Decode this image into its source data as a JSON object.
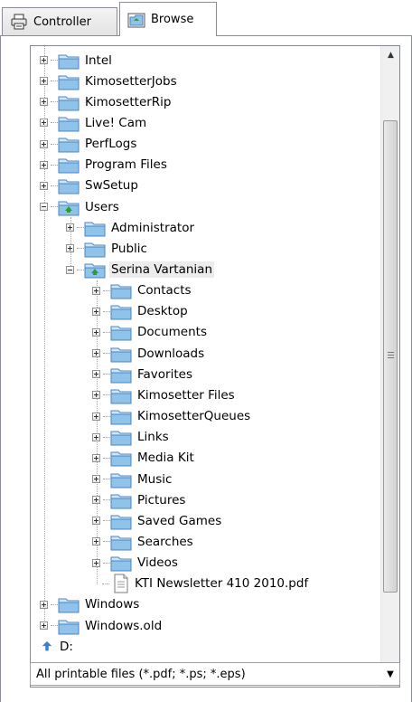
{
  "tabs": [
    {
      "label": "Controller",
      "icon": "printer-icon",
      "active": false
    },
    {
      "label": "Browse",
      "icon": "browse-folder-icon",
      "active": true
    }
  ],
  "tree": {
    "items": [
      {
        "label": "Intel",
        "depth": 0,
        "expander": "plus",
        "icon": "folder-icon"
      },
      {
        "label": "KimosetterJobs",
        "depth": 0,
        "expander": "plus",
        "icon": "folder-icon"
      },
      {
        "label": "KimosetterRip",
        "depth": 0,
        "expander": "plus",
        "icon": "folder-icon"
      },
      {
        "label": "Live! Cam",
        "depth": 0,
        "expander": "plus",
        "icon": "folder-icon"
      },
      {
        "label": "PerfLogs",
        "depth": 0,
        "expander": "plus",
        "icon": "folder-icon"
      },
      {
        "label": "Program Files",
        "depth": 0,
        "expander": "plus",
        "icon": "folder-icon"
      },
      {
        "label": "SwSetup",
        "depth": 0,
        "expander": "plus",
        "icon": "folder-icon"
      },
      {
        "label": "Users",
        "depth": 0,
        "expander": "minus",
        "icon": "user-folder-icon"
      },
      {
        "label": "Administrator",
        "depth": 1,
        "expander": "plus",
        "icon": "folder-icon"
      },
      {
        "label": "Public",
        "depth": 1,
        "expander": "plus",
        "icon": "folder-icon"
      },
      {
        "label": "Serina Vartanian",
        "depth": 1,
        "expander": "minus",
        "icon": "user-folder-icon",
        "selected": true
      },
      {
        "label": "Contacts",
        "depth": 2,
        "expander": "plus",
        "icon": "folder-icon"
      },
      {
        "label": "Desktop",
        "depth": 2,
        "expander": "plus",
        "icon": "folder-icon"
      },
      {
        "label": "Documents",
        "depth": 2,
        "expander": "plus",
        "icon": "folder-icon"
      },
      {
        "label": "Downloads",
        "depth": 2,
        "expander": "plus",
        "icon": "folder-icon"
      },
      {
        "label": "Favorites",
        "depth": 2,
        "expander": "plus",
        "icon": "folder-icon"
      },
      {
        "label": "Kimosetter Files",
        "depth": 2,
        "expander": "plus",
        "icon": "folder-icon"
      },
      {
        "label": "KimosetterQueues",
        "depth": 2,
        "expander": "plus",
        "icon": "folder-icon"
      },
      {
        "label": "Links",
        "depth": 2,
        "expander": "plus",
        "icon": "folder-icon"
      },
      {
        "label": "Media Kit",
        "depth": 2,
        "expander": "plus",
        "icon": "folder-icon"
      },
      {
        "label": "Music",
        "depth": 2,
        "expander": "plus",
        "icon": "folder-icon"
      },
      {
        "label": "Pictures",
        "depth": 2,
        "expander": "plus",
        "icon": "folder-icon"
      },
      {
        "label": "Saved Games",
        "depth": 2,
        "expander": "plus",
        "icon": "folder-icon"
      },
      {
        "label": "Searches",
        "depth": 2,
        "expander": "plus",
        "icon": "folder-icon"
      },
      {
        "label": "Videos",
        "depth": 2,
        "expander": "plus",
        "icon": "folder-icon"
      },
      {
        "label": "KTI Newsletter 410 2010.pdf",
        "depth": 2,
        "expander": "none",
        "icon": "pdf-file-icon"
      },
      {
        "label": "Windows",
        "depth": 0,
        "expander": "plus",
        "icon": "folder-icon"
      },
      {
        "label": "Windows.old",
        "depth": 0,
        "expander": "plus",
        "icon": "folder-icon"
      },
      {
        "label": "D:",
        "depth": -1,
        "expander": "none",
        "icon": "drive-icon"
      }
    ]
  },
  "filter": {
    "selected": "All printable files (*.pdf; *.ps; *.eps)"
  },
  "colors": {
    "folder": "#8fc3ea",
    "folder_dark": "#4d86c0",
    "user_folder_badge": "#2e9a3b",
    "selection": "#ececec"
  }
}
